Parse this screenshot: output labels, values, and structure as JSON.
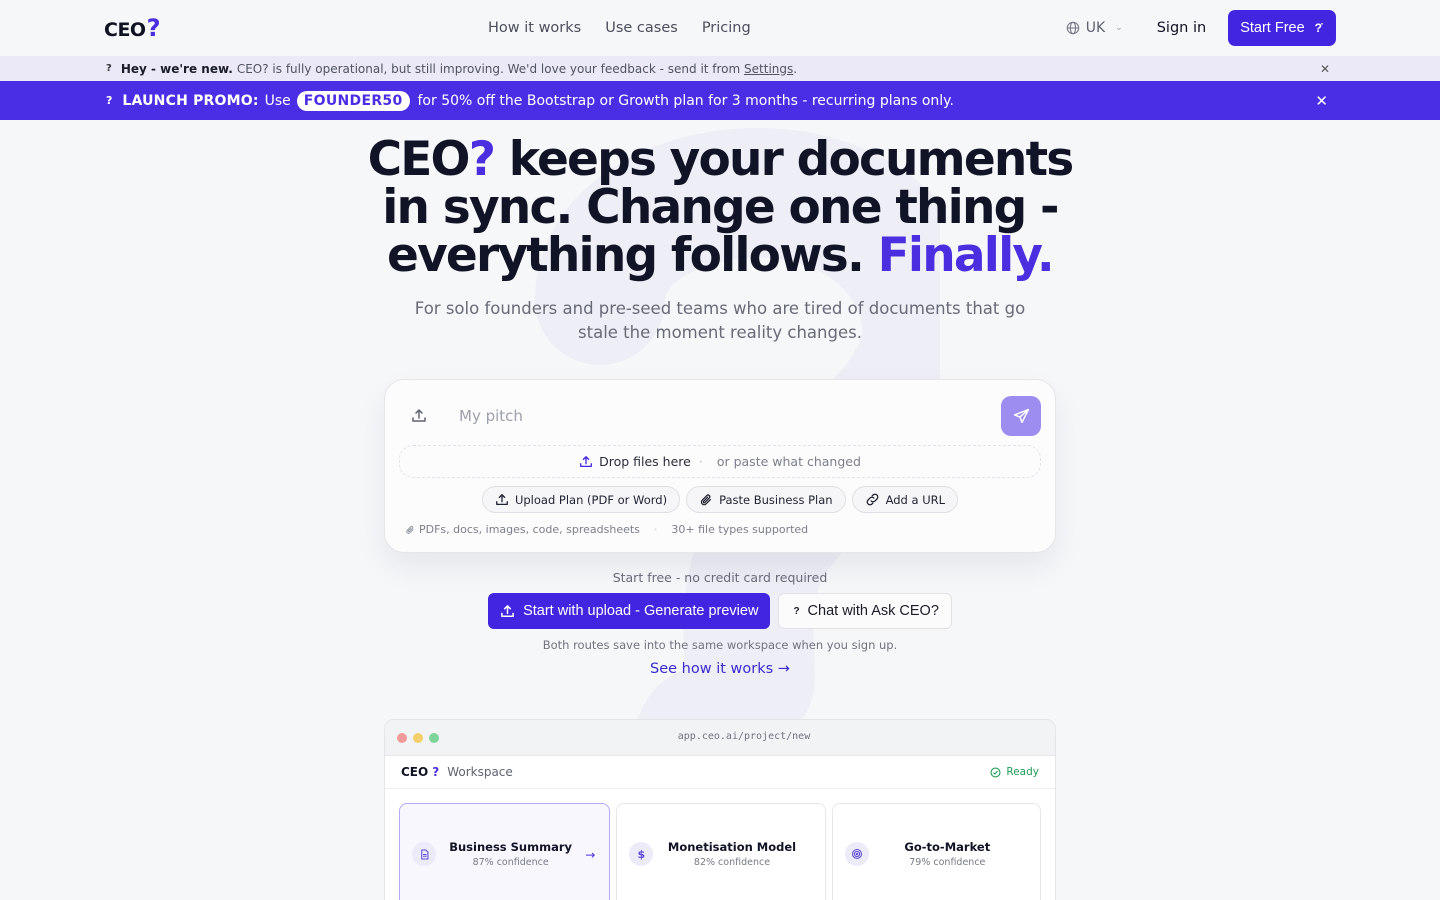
{
  "nav": {
    "logo_text": "CEO",
    "logo_mark": "?",
    "links": [
      "How it works",
      "Use cases",
      "Pricing"
    ],
    "language": "UK",
    "sign_in": "Sign in",
    "start_free": "Start Free"
  },
  "announcement": {
    "bold": "Hey - we're new.",
    "text": "CEO? is fully operational, but still improving. We'd love your feedback - send it from ",
    "link": "Settings",
    "tail": "."
  },
  "promo": {
    "label": "LAUNCH PROMO:",
    "pre": "Use",
    "code": "FOUNDER50",
    "post": "for 50% off the Bootstrap or Growth plan for 3 months - recurring plans only."
  },
  "hero": {
    "h_brand": "CEO",
    "h_mark": "?",
    "h_rest": " keeps your documents in sync. Change one thing - everything follows. ",
    "h_accent": "Finally.",
    "subtitle": "For solo founders and pre-seed teams who are tired of documents that go stale the moment reality changes."
  },
  "composer": {
    "placeholder": "My pitch",
    "drop_label": "Drop files here",
    "drop_alt": "or paste what changed",
    "chips": [
      "Upload Plan (PDF or Word)",
      "Paste Business Plan",
      "Add a URL"
    ],
    "meta_formats": "PDFs, docs, images, code, spreadsheets",
    "meta_count": "30+ file types supported"
  },
  "cta": {
    "free_note": "Start free - no credit card required",
    "primary": "Start with upload - Generate preview",
    "secondary": "Chat with Ask CEO?",
    "both_note": "Both routes save into the same workspace when you sign up.",
    "see_how": "See how it works →"
  },
  "preview": {
    "url": "app.ceo.ai/project/new",
    "brand": "CEO",
    "brand_mark": "?",
    "workspace": "Workspace",
    "status": "Ready",
    "tiles": [
      {
        "title": "Business Summary",
        "confidence": "87% confidence",
        "icon": "document-icon"
      },
      {
        "title": "Monetisation Model",
        "confidence": "82% confidence",
        "icon": "dollar-icon"
      },
      {
        "title": "Go-to-Market",
        "confidence": "79% confidence",
        "icon": "target-icon"
      }
    ]
  },
  "colors": {
    "accent": "#4225e0",
    "promo_bg": "#4a2ee6",
    "announce_bg": "#ebe9f8",
    "ready": "#1f9d55"
  }
}
